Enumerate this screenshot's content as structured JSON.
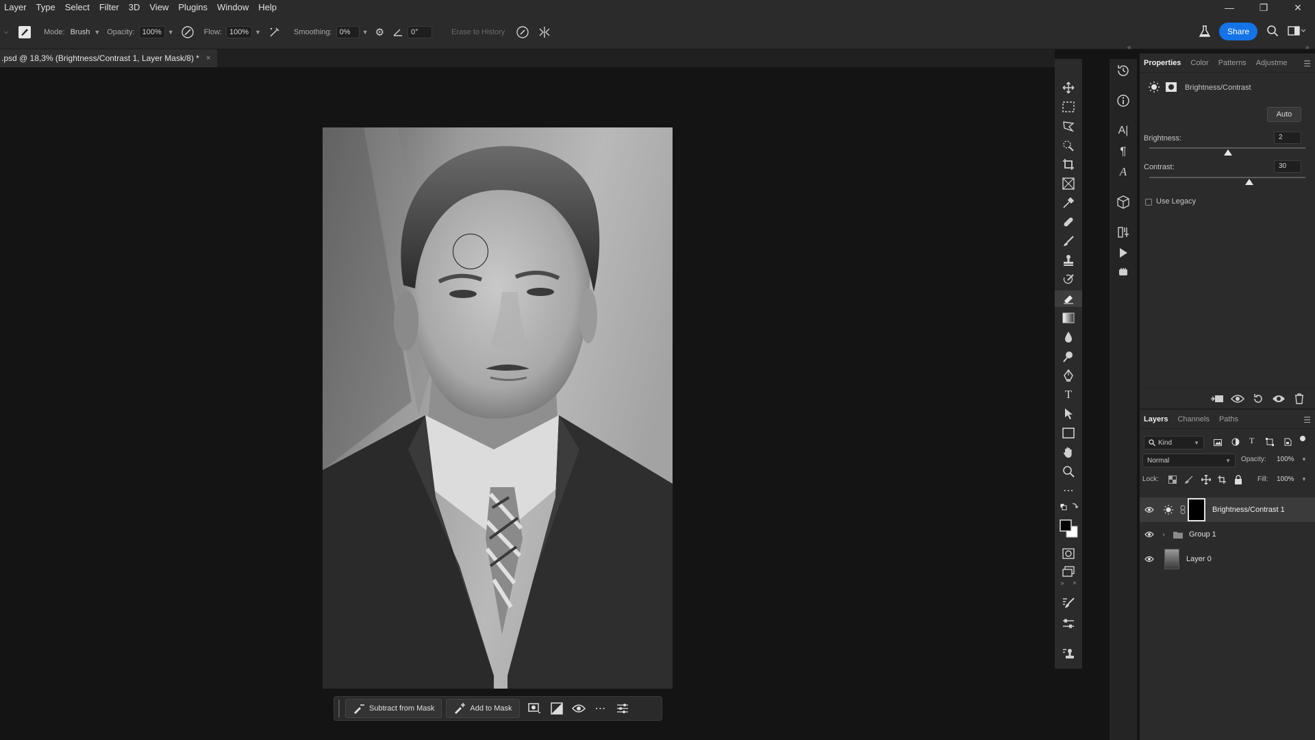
{
  "menubar": {
    "items": [
      "Layer",
      "Type",
      "Select",
      "Filter",
      "3D",
      "View",
      "Plugins",
      "Window",
      "Help"
    ],
    "window_controls": [
      "minimize",
      "restore",
      "close"
    ]
  },
  "options_bar": {
    "mode_label": "Mode:",
    "mode_value": "Brush",
    "opacity_label": "Opacity:",
    "opacity_value": "100%",
    "flow_label": "Flow:",
    "flow_value": "100%",
    "smoothing_label": "Smoothing:",
    "smoothing_value": "0%",
    "angle_value": "0°",
    "erase_to_history": "Erase to History",
    "share_label": "Share"
  },
  "document": {
    "tab_title": ".psd @ 18,3% (Brightness/Contrast 1, Layer Mask/8) *",
    "close_symbol": "×"
  },
  "taskbar": {
    "subtract_label": "Subtract from Mask",
    "add_label": "Add to Mask"
  },
  "properties": {
    "tabs": [
      "Properties",
      "Color",
      "Patterns",
      "Adjustme"
    ],
    "adjustment_title": "Brightness/Contrast",
    "auto_label": "Auto",
    "brightness_label": "Brightness:",
    "brightness_value": "2",
    "brightness_level": 0.505,
    "contrast_label": "Contrast:",
    "contrast_value": "30",
    "contrast_level": 0.64,
    "use_legacy_label": "Use Legacy",
    "use_legacy_checked": false
  },
  "layers": {
    "tabs": [
      "Layers",
      "Channels",
      "Paths"
    ],
    "filter_label": "Kind",
    "blend_mode": "Normal",
    "opacity_label": "Opacity:",
    "opacity_value": "100%",
    "lock_label": "Lock:",
    "fill_label": "Fill:",
    "fill_value": "100%",
    "items": [
      {
        "name": "Brightness/Contrast 1",
        "type": "adjustment",
        "selected": true
      },
      {
        "name": "Group 1",
        "type": "group",
        "selected": false
      },
      {
        "name": "Layer 0",
        "type": "pixel",
        "selected": false
      }
    ]
  },
  "colors": {
    "accent": "#1473e6",
    "panel_bg": "#2b2b2b",
    "canvas_bg": "#141414"
  }
}
